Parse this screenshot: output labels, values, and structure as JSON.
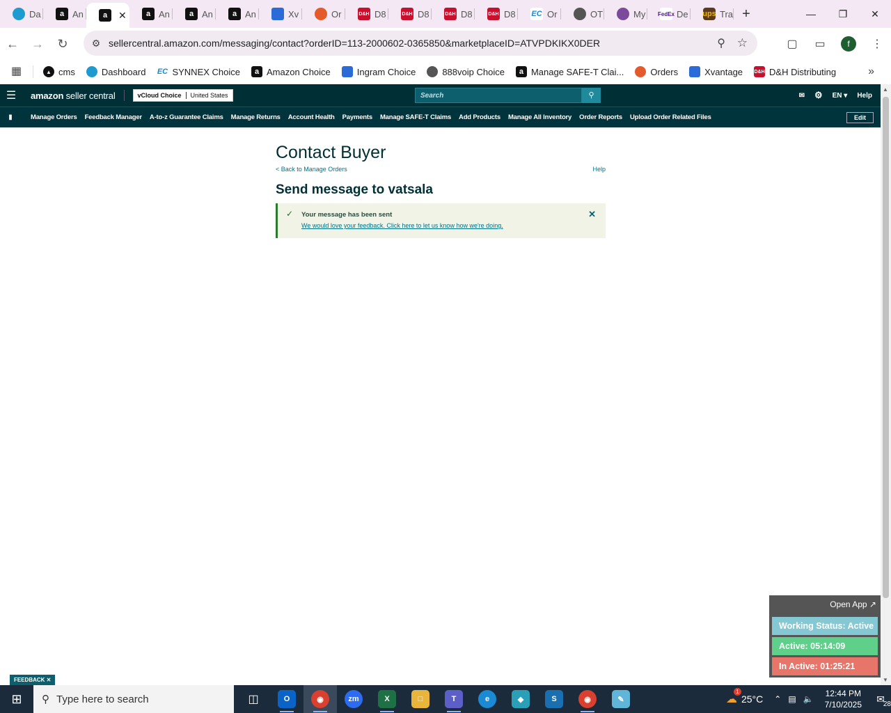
{
  "browser": {
    "tabs": [
      {
        "icon": "teal",
        "label": "Da"
      },
      {
        "icon": "amz",
        "label": "An"
      },
      {
        "icon": "amz",
        "label": "",
        "active": true
      },
      {
        "icon": "amz",
        "label": "An"
      },
      {
        "icon": "amz",
        "label": "An"
      },
      {
        "icon": "amz",
        "label": "An"
      },
      {
        "icon": "blue",
        "label": "Xv"
      },
      {
        "icon": "orange",
        "label": "Or"
      },
      {
        "icon": "dh",
        "label": "D8"
      },
      {
        "icon": "dh",
        "label": "D8"
      },
      {
        "icon": "dh",
        "label": "D8"
      },
      {
        "icon": "dh",
        "label": "D8"
      },
      {
        "icon": "ec",
        "label": "Or"
      },
      {
        "icon": "gray",
        "label": "OT"
      },
      {
        "icon": "my",
        "label": "My"
      },
      {
        "icon": "fedex",
        "label": "De"
      },
      {
        "icon": "ups",
        "label": "Tra"
      }
    ],
    "url": "sellercentral.amazon.com/messaging/contact?orderID=113-2000602-0365850&marketplaceID=ATVPDKIKX0DER",
    "profile_initial": "f",
    "bookmarks": [
      {
        "icon": "cms",
        "label": "cms"
      },
      {
        "icon": "teal",
        "label": "Dashboard"
      },
      {
        "icon": "ec",
        "label": "SYNNEX Choice"
      },
      {
        "icon": "amz",
        "label": "Amazon Choice"
      },
      {
        "icon": "blue",
        "label": "Ingram Choice"
      },
      {
        "icon": "gray",
        "label": "888voip Choice"
      },
      {
        "icon": "amz",
        "label": "Manage SAFE-T Clai..."
      },
      {
        "icon": "orange",
        "label": "Orders"
      },
      {
        "icon": "blue",
        "label": "Xvantage"
      },
      {
        "icon": "dh",
        "label": "D&H Distributing"
      }
    ]
  },
  "seller_central": {
    "logo_bold": "amazon",
    "logo_rest": " seller central",
    "store_name": "vCloud Choice",
    "store_country": "United States",
    "search_placeholder": "Search",
    "language": "EN",
    "help": "Help",
    "nav": [
      "Manage Orders",
      "Feedback Manager",
      "A-to-z Guarantee Claims",
      "Manage Returns",
      "Account Health",
      "Payments",
      "Manage SAFE-T Claims",
      "Add Products",
      "Manage All Inventory",
      "Order Reports",
      "Upload Order Related Files"
    ],
    "edit": "Edit"
  },
  "page": {
    "title": "Contact Buyer",
    "back_link": "< Back to Manage Orders",
    "help_link": "Help",
    "send_heading": "Send message to vatsala",
    "alert_title": "Your message has been sent",
    "alert_link": "We would love your feedback. Click here to let us know how we're doing."
  },
  "widget": {
    "open_app": "Open App ↗",
    "status": "Working Status: Active",
    "active": "Active: 05:14:09",
    "inactive": "In Active: 01:25:21",
    "colors": {
      "status": "#84c8d4",
      "active": "#5fd08a",
      "inactive": "#e8756a"
    }
  },
  "feedback_tab": "FEEDBACK ✕",
  "taskbar": {
    "search_placeholder": "Type here to search",
    "temperature": "25°C",
    "time": "12:44 PM",
    "date": "7/10/2025",
    "notification_count": "28",
    "weather_badge": "1"
  }
}
